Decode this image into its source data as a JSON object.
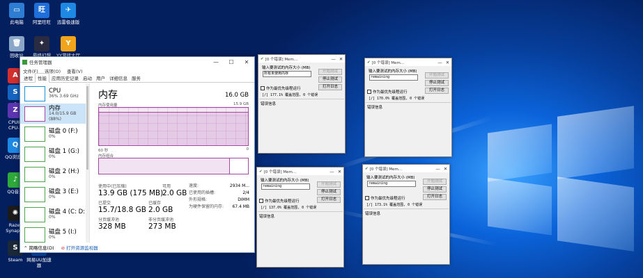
{
  "desktop_icons": [
    {
      "label": "此电脑",
      "color": "#2d7dd2",
      "glyph": "▭",
      "icon": "computer-icon"
    },
    {
      "label": "阿里旺旺",
      "color": "#1e6fd9",
      "glyph": "旺",
      "icon": "aliwangwang-icon"
    },
    {
      "label": "迅雷极速版",
      "color": "#1e88e5",
      "glyph": "✈",
      "icon": "xunlei-icon"
    },
    {
      "label": "回收站",
      "color": "#8aa7c7",
      "glyph": "🗑",
      "icon": "recycle-bin-icon"
    },
    {
      "label": "最终幻想",
      "color": "#2a2a40",
      "glyph": "✦",
      "icon": "game-icon"
    },
    {
      "label": "YY游戏大厅",
      "color": "#f2a51a",
      "glyph": "Y",
      "icon": "yy-icon"
    },
    {
      "label": "R",
      "color": "#d32f2f",
      "glyph": "A",
      "icon": "pdf-icon"
    },
    {
      "label": "S",
      "color": "#1565c0",
      "glyph": "S",
      "icon": "security-icon"
    },
    {
      "label": "CPUID CPU-Z",
      "color": "#5e35b1",
      "glyph": "Z",
      "icon": "cpuz-icon"
    },
    {
      "label": "QQ浏览器",
      "color": "#1e88e5",
      "glyph": "Q",
      "icon": "qq-browser-icon"
    },
    {
      "label": "QQ音乐",
      "color": "#2eaa3a",
      "glyph": "♪",
      "icon": "qq-music-icon"
    },
    {
      "label": "Razer Synapse",
      "color": "#1b1b1b",
      "glyph": "✺",
      "icon": "razer-icon"
    },
    {
      "label": "Steam",
      "color": "#1b2838",
      "glyph": "S",
      "icon": "steam-icon"
    },
    {
      "label": "网易UU加速器",
      "color": "#0d47a1",
      "glyph": "UU",
      "icon": "uu-icon"
    }
  ],
  "taskmgr": {
    "title": "任务管理器",
    "menus": [
      "文件(F)",
      "选项(O)",
      "查看(V)"
    ],
    "tabs": [
      "进程",
      "性能",
      "应用历史记录",
      "启动",
      "用户",
      "详细信息",
      "服务"
    ],
    "active_tab": 1,
    "sidebar": [
      {
        "title": "CPU",
        "sub": "36% 3.69 GHz",
        "thumb": "blue"
      },
      {
        "title": "内存",
        "sub": "14.0/15.9 GB (88%)",
        "thumb": "purple",
        "selected": true
      },
      {
        "title": "磁盘 0 (F:)",
        "sub": "0%",
        "thumb": "green"
      },
      {
        "title": "磁盘 1 (G:)",
        "sub": "0%",
        "thumb": "green"
      },
      {
        "title": "磁盘 2 (H:)",
        "sub": "0%",
        "thumb": "green"
      },
      {
        "title": "磁盘 3 (E:)",
        "sub": "0%",
        "thumb": "green"
      },
      {
        "title": "磁盘 4 (C: D:)",
        "sub": "0%",
        "thumb": "green"
      },
      {
        "title": "磁盘 5 (I:)",
        "sub": "0%",
        "thumb": "green"
      }
    ],
    "main": {
      "title": "内存",
      "total": "16.0 GB",
      "usage_label": "内存使用量",
      "usage_max": "15.9 GB",
      "usage_fraction": 0.88,
      "time_label": "60 秒",
      "zero_label": "0",
      "composition_label": "内存组合",
      "inuse_fraction": 0.88,
      "stats": {
        "inuse_label": "使用中(已压缩)",
        "inuse_value": "13.9 GB (175 MB)",
        "available_label": "可用",
        "available_value": "2.0 GB",
        "committed_label": "已提交",
        "committed_value": "15.7/18.8 GB",
        "cached_label": "已缓存",
        "cached_value": "2.0 GB",
        "paged_label": "分页缓冲池",
        "paged_value": "328 MB",
        "nonpaged_label": "非分页缓冲池",
        "nonpaged_value": "273 MB"
      },
      "specs": [
        {
          "k": "速度:",
          "v": "2934 M..."
        },
        {
          "k": "已使用的插槽:",
          "v": "2/4"
        },
        {
          "k": "外形规格:",
          "v": "DIMM"
        },
        {
          "k": "为硬件保留的内存:",
          "v": "67.4 MB"
        }
      ]
    },
    "footer": {
      "less": "简略信息(D)",
      "monitor": "打开资源监视器"
    }
  },
  "memwins": [
    {
      "title": "[0 个错误] Mem...",
      "label": "输入要测试的内存大小 (MB)",
      "input": "所有未使用内存",
      "start": "开始测试",
      "stop": "停止测试",
      "log": "打开日志",
      "check": "作为最优先级程运行",
      "status": "[/]   177.1% 覆盖范围, 0 个错误",
      "err": "错误信息"
    },
    {
      "title": "[0 个错误] Mem...",
      "label": "输入要测试的内存大小 (MB)",
      "input": "remaining",
      "start": "开始测试",
      "stop": "停止测试",
      "log": "打开日志",
      "check": "作为最优先级程运行",
      "status": "[/]   170.0% 覆盖范围, 0 个错误",
      "err": "错误信息"
    },
    {
      "title": "[0 个错误] Mem...",
      "label": "输入要测试的内存大小 (MB)",
      "input": "remaining",
      "start": "开始测试",
      "stop": "停止测试",
      "log": "打开日志",
      "check": "作为最优先级程运行",
      "status": "[/]   137.0% 覆盖范围, 0 个错误",
      "err": "错误信息"
    },
    {
      "title": "[0 个错误] Mem...",
      "label": "输入要测试的内存大小 (MB)",
      "input": "remaining",
      "start": "开始测试",
      "stop": "停止测试",
      "log": "打开日志",
      "check": "作为最优先级程运行",
      "status": "[/]   173.1% 覆盖范围, 0 个错误",
      "err": "错误信息"
    }
  ]
}
